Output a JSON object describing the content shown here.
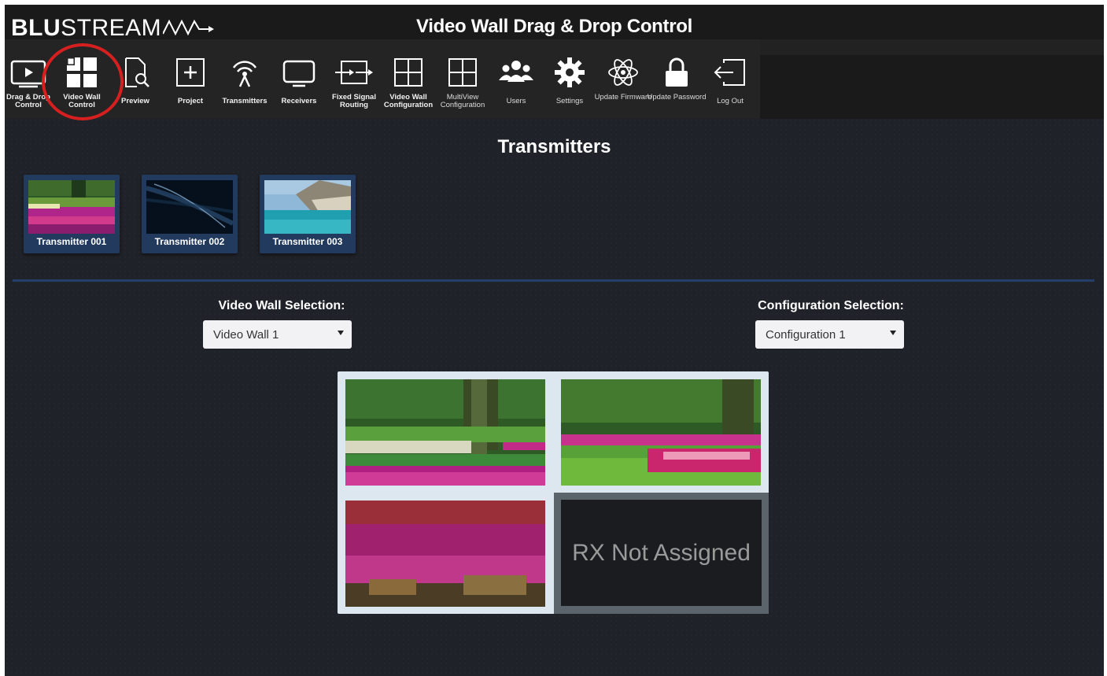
{
  "brand": {
    "logo_bold": "BLU",
    "logo_thin": "STREAM"
  },
  "header": {
    "title": "Video Wall Drag & Drop Control"
  },
  "toolbar": [
    {
      "id": "drag-drop-control",
      "label": "Drag & Drop Control",
      "icon": "play-screen-icon"
    },
    {
      "id": "video-wall-control",
      "label": "Video Wall Control",
      "icon": "four-square-grid-icon",
      "active": true
    },
    {
      "id": "preview",
      "label": "Preview",
      "icon": "document-search-icon"
    },
    {
      "id": "project",
      "label": "Project",
      "icon": "plus-box-icon"
    },
    {
      "id": "transmitters",
      "label": "Transmitters",
      "icon": "antenna-icon"
    },
    {
      "id": "receivers",
      "label": "Receivers",
      "icon": "monitor-icon"
    },
    {
      "id": "fixed-signal-routing",
      "label": "Fixed Signal Routing",
      "icon": "routing-arrows-icon"
    },
    {
      "id": "video-wall-configuration",
      "label": "Video Wall Configuration",
      "icon": "grid-icon"
    },
    {
      "id": "multiview-configuration",
      "label": "MultiView Configuration",
      "icon": "grid-icon"
    },
    {
      "id": "users",
      "label": "Users",
      "icon": "users-icon"
    },
    {
      "id": "settings",
      "label": "Settings",
      "icon": "gear-icon"
    },
    {
      "id": "update-firmware",
      "label": "Update Firmware",
      "icon": "atom-icon"
    },
    {
      "id": "update-password",
      "label": "Update Password",
      "icon": "lock-icon"
    },
    {
      "id": "log-out",
      "label": "Log Out",
      "icon": "logout-icon"
    }
  ],
  "transmitters": {
    "title": "Transmitters",
    "items": [
      {
        "name": "Transmitter 001",
        "thumb": "tulip-garden"
      },
      {
        "name": "Transmitter 002",
        "thumb": "night-water"
      },
      {
        "name": "Transmitter 003",
        "thumb": "coastal-cliffs"
      }
    ]
  },
  "video_wall_selection": {
    "label": "Video Wall Selection:",
    "value": "Video Wall 1"
  },
  "configuration_selection": {
    "label": "Configuration Selection:",
    "value": "Configuration 1"
  },
  "wall": {
    "screens": [
      {
        "position": "top-left",
        "content": "tulip-garden"
      },
      {
        "position": "top-right",
        "content": "tulip-garden"
      },
      {
        "position": "bottom-left",
        "content": "tulips-closeup"
      },
      {
        "position": "bottom-right",
        "status": "RX Not Assigned"
      }
    ]
  },
  "colors": {
    "accent_circle": "#d62020",
    "card_bg": "#213a5e",
    "divider": "#24406a"
  }
}
